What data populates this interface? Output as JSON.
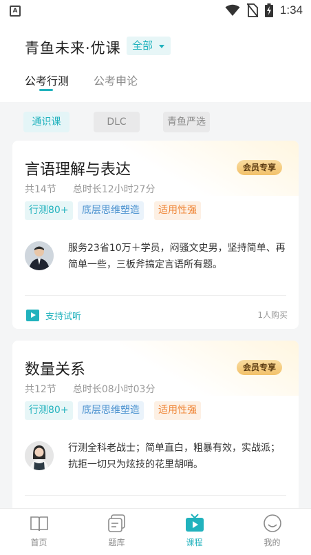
{
  "status_bar": {
    "time": "1:34",
    "icons": [
      "notification-a-icon",
      "wifi-icon",
      "no-sim-icon",
      "battery-charging-icon"
    ]
  },
  "header": {
    "brand": "青鱼未来·优课",
    "scope_selector": "全部",
    "tabs": [
      {
        "label": "公考行测",
        "active": true
      },
      {
        "label": "公考申论",
        "active": false
      }
    ]
  },
  "filters": [
    {
      "label": "通识课",
      "active": true
    },
    {
      "label": "DLC",
      "active": false
    },
    {
      "label": "青鱼严选",
      "active": false
    }
  ],
  "courses": [
    {
      "title": "言语理解与表达",
      "badge": "会员专享",
      "lessons": "共14节",
      "duration": "总时长12小时27分",
      "tags": [
        "行测80+",
        "底层思维塑造",
        "适用性强"
      ],
      "description": "服务23省10万＋学员，闷骚文史男，坚持简单、再简单一些，三板斧搞定言语所有题。",
      "trial_label": "支持试听",
      "buyers": "1人购买"
    },
    {
      "title": "数量关系",
      "badge": "会员专享",
      "lessons": "共12节",
      "duration": "总时长08小时03分",
      "tags": [
        "行测80+",
        "底层思维塑造",
        "适用性强"
      ],
      "description": "行测全科老战士；简单直白，粗暴有效，实战派；抗拒一切只为炫技的花里胡哨。"
    }
  ],
  "bottom_nav": [
    {
      "label": "首页",
      "icon": "book-icon",
      "active": false
    },
    {
      "label": "题库",
      "icon": "question-bank-icon",
      "active": false
    },
    {
      "label": "课程",
      "icon": "tv-play-icon",
      "active": true
    },
    {
      "label": "我的",
      "icon": "smile-face-icon",
      "active": false
    }
  ],
  "colors": {
    "accent": "#21b2bd",
    "vip_gold": "#f2c16a",
    "tag_orange": "#ee8333",
    "tag_blue": "#4a91cf"
  }
}
